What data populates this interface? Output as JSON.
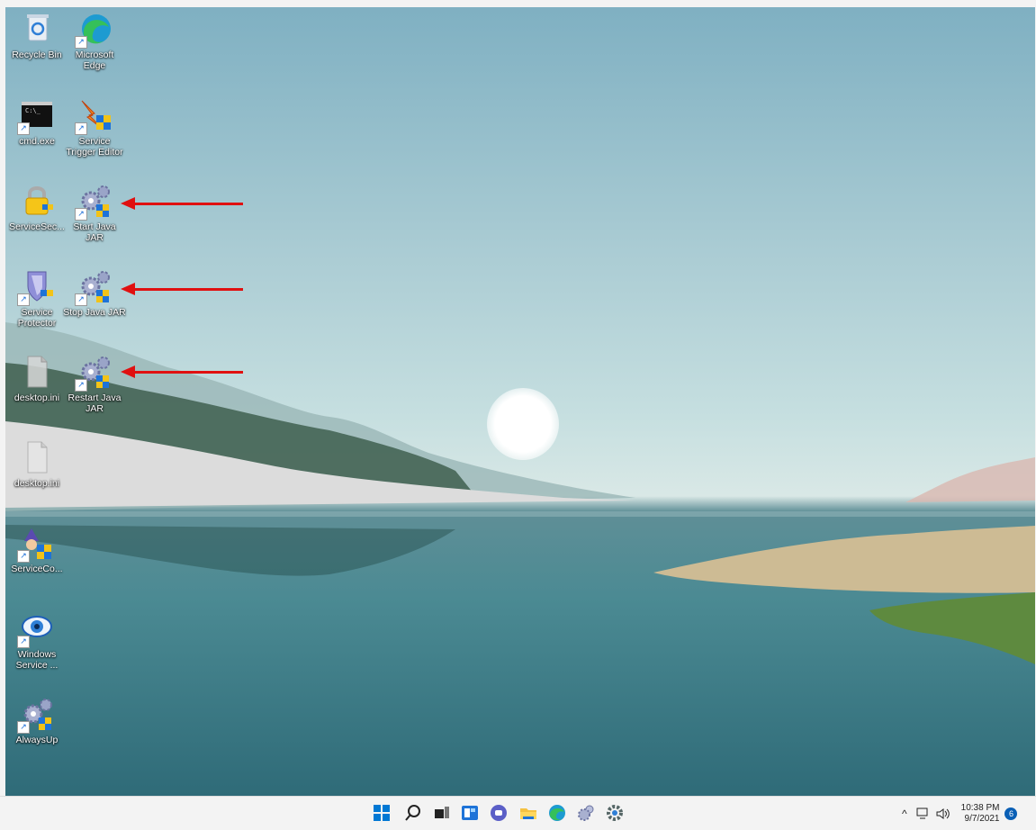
{
  "desktop": {
    "icons": [
      {
        "label": "Recycle Bin",
        "icon": "recycle-bin-icon"
      },
      {
        "label": "Microsoft Edge",
        "icon": "edge-icon"
      },
      {
        "label": "cmd.exe",
        "icon": "cmd-icon"
      },
      {
        "label": "Service Trigger Editor",
        "icon": "trigger-editor-icon"
      },
      {
        "label": "ServiceSec...",
        "icon": "lock-icon"
      },
      {
        "label": "Start Java JAR",
        "icon": "gears-icon"
      },
      {
        "label": "Service Protector",
        "icon": "shield-icon"
      },
      {
        "label": "Stop Java JAR",
        "icon": "gears-icon"
      },
      {
        "label": "desktop.ini",
        "icon": "file-icon"
      },
      {
        "label": "Restart Java JAR",
        "icon": "gears-icon"
      },
      {
        "label": "desktop.ini",
        "icon": "file-icon"
      },
      {
        "label": "ServiceCo...",
        "icon": "wizard-icon"
      },
      {
        "label": "Windows Service ...",
        "icon": "eye-icon"
      },
      {
        "label": "AlwaysUp",
        "icon": "gears-icon"
      }
    ]
  },
  "taskbar": {
    "clock_time": "10:38 PM",
    "clock_date": "9/7/2021",
    "notification_count": "6",
    "tray_chevron": "^",
    "colors": {
      "start": "#0078d4",
      "arrow": "#e01010"
    }
  }
}
